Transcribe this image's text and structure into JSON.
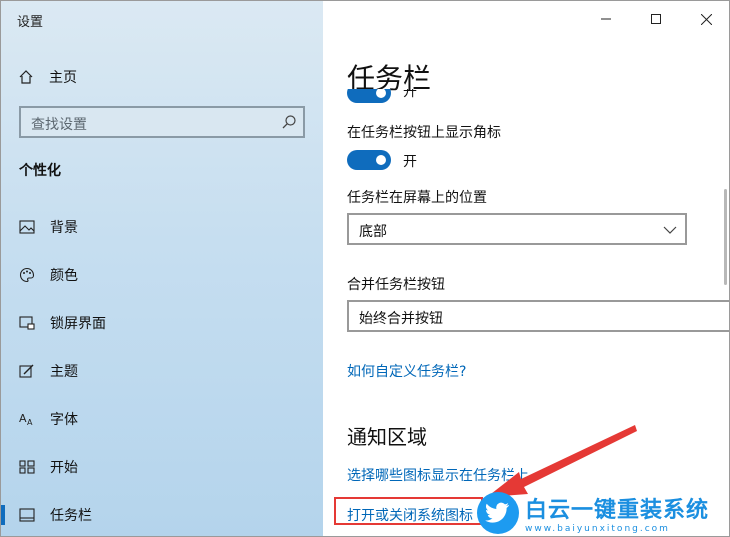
{
  "window": {
    "app_title": "设置"
  },
  "sidebar": {
    "home_label": "主页",
    "search_placeholder": "查找设置",
    "section_title": "个性化",
    "items": [
      {
        "label": "背景",
        "icon": "image-icon"
      },
      {
        "label": "颜色",
        "icon": "palette-icon"
      },
      {
        "label": "锁屏界面",
        "icon": "lock-screen-icon"
      },
      {
        "label": "主题",
        "icon": "theme-icon"
      },
      {
        "label": "字体",
        "icon": "font-icon"
      },
      {
        "label": "开始",
        "icon": "start-icon"
      },
      {
        "label": "任务栏",
        "icon": "taskbar-icon",
        "selected": true
      }
    ]
  },
  "content": {
    "page_title": "任务栏",
    "top_toggle": {
      "state_label": "开",
      "on": true
    },
    "badges_setting": {
      "label": "在任务栏按钮上显示角标",
      "state_label": "开",
      "on": true
    },
    "position_setting": {
      "label": "任务栏在屏幕上的位置",
      "value": "底部"
    },
    "combine_setting": {
      "label": "合并任务栏按钮",
      "value": "始终合并按钮"
    },
    "customize_link": "如何自定义任务栏?",
    "notification_section": {
      "title": "通知区域",
      "link1": "选择哪些图标显示在任务栏上",
      "link2": "打开或关闭系统图标"
    }
  },
  "watermark": {
    "main": "白云一键重装系统",
    "url": "www.baiyunxitong.com"
  },
  "colors": {
    "accent": "#0f6cbd",
    "link": "#0067b8",
    "highlight": "#e53935"
  }
}
